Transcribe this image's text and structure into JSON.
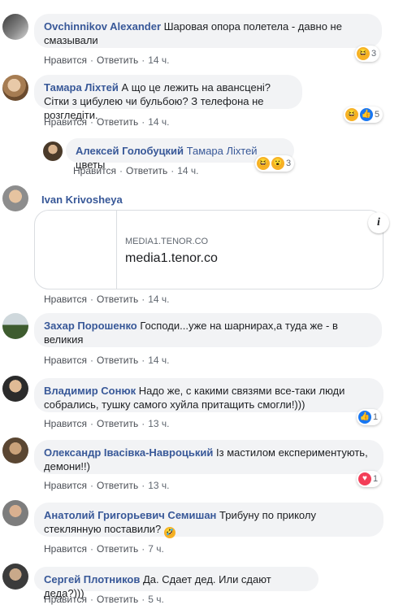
{
  "actions": {
    "like": "Нравится",
    "reply": "Ответить",
    "sep": "·"
  },
  "comments": [
    {
      "author": "Ovchinnikov Alexander",
      "text": "Шаровая опора полетела - давно не смазывали",
      "time": "14 ч.",
      "reactions": {
        "icons": [
          "haha"
        ],
        "count": "3"
      }
    },
    {
      "author": "Тамара Ліхтей",
      "text": "А що це лежить на авансцені? Сітки з цибулею чи бульбою? З телефона не розгледіти.",
      "time": "14 ч.",
      "reactions": {
        "icons": [
          "haha",
          "like"
        ],
        "count": "5"
      }
    },
    {
      "author": "Алексей Голобуцкий",
      "mention": "Тамара Ліхтей",
      "text": "цветы",
      "time": "14 ч.",
      "reactions": {
        "icons": [
          "haha",
          "wow"
        ],
        "count": "3"
      }
    },
    {
      "author": "Ivan Krivosheya",
      "time": "14 ч.",
      "link": {
        "domain": "MEDIA1.TENOR.CO",
        "title": "media1.tenor.co"
      }
    },
    {
      "author": "Захар Порошенко",
      "text": "Господи...уже на шарнирах,а туда же - в великия",
      "time": "14 ч."
    },
    {
      "author": "Владимир Сонюк",
      "text": "Надо же, с какими связями все-таки люди собрались, тушку самого хуйла притащить смогли!)))",
      "time": "13 ч.",
      "reactions": {
        "icons": [
          "like"
        ],
        "count": "1"
      }
    },
    {
      "author": "Олександр Івасівка-Навроцький",
      "text": "Із мастилом експериментують, демони!!)",
      "time": "13 ч.",
      "reactions": {
        "icons": [
          "love"
        ],
        "count": "1"
      }
    },
    {
      "author": "Анатолий Григорьевич Семишан",
      "text": "Трибуну по приколу стеклянную поставили?",
      "time": "7 ч."
    },
    {
      "author": "Сергей Плотников",
      "text": "Да. Сдает дед. Или сдают деда?)))",
      "time": "5 ч."
    }
  ]
}
